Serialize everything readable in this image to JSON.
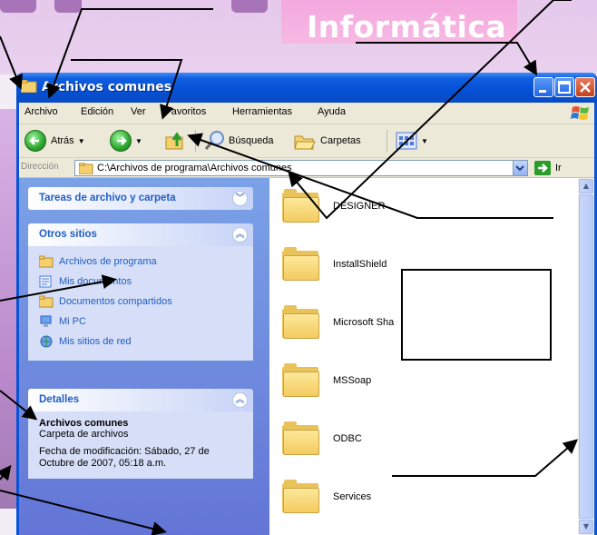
{
  "banner": {
    "subtitle": "Informática"
  },
  "window": {
    "title": "Archivos comunes",
    "menu": [
      "Archivo",
      "Edición",
      "Ver",
      "Favoritos",
      "Herramientas",
      "Ayuda"
    ],
    "toolbar": {
      "back": "Atrás",
      "search": "Búsqueda",
      "folders": "Carpetas"
    },
    "address": {
      "label": "Dirección",
      "path": "C:\\Archivos de programa\\Archivos comunes",
      "go": "Ir"
    }
  },
  "taskpane": {
    "tasks_title": "Tareas de archivo y carpeta",
    "places_title": "Otros sitios",
    "places": [
      "Archivos de programa",
      "Mis documentos",
      "Documentos compartidos",
      "Mi PC",
      "Mis sitios de red"
    ],
    "details_title": "Detalles",
    "details": {
      "name": "Archivos comunes",
      "type": "Carpeta de archivos",
      "modified_1": "Fecha de modificación: Sábado, 27 de",
      "modified_2": "Octubre de 2007, 05:18 a.m."
    }
  },
  "files": [
    "DESIGNER",
    "InstallShield",
    "Microsoft Sha",
    "MSSoap",
    "ODBC",
    "Services"
  ],
  "icons": {
    "title": "folder-icon",
    "back": "back-arrow-icon",
    "forward": "forward-arrow-icon",
    "up": "folder-up-icon",
    "search": "search-icon",
    "folders": "folders-icon",
    "views": "views-icon",
    "go": "go-arrow-icon"
  },
  "colors": {
    "titlebar": "#0550d4",
    "menubar": "#ece9d8",
    "taskpane": "#6f8fe0",
    "link": "#215dc6"
  }
}
